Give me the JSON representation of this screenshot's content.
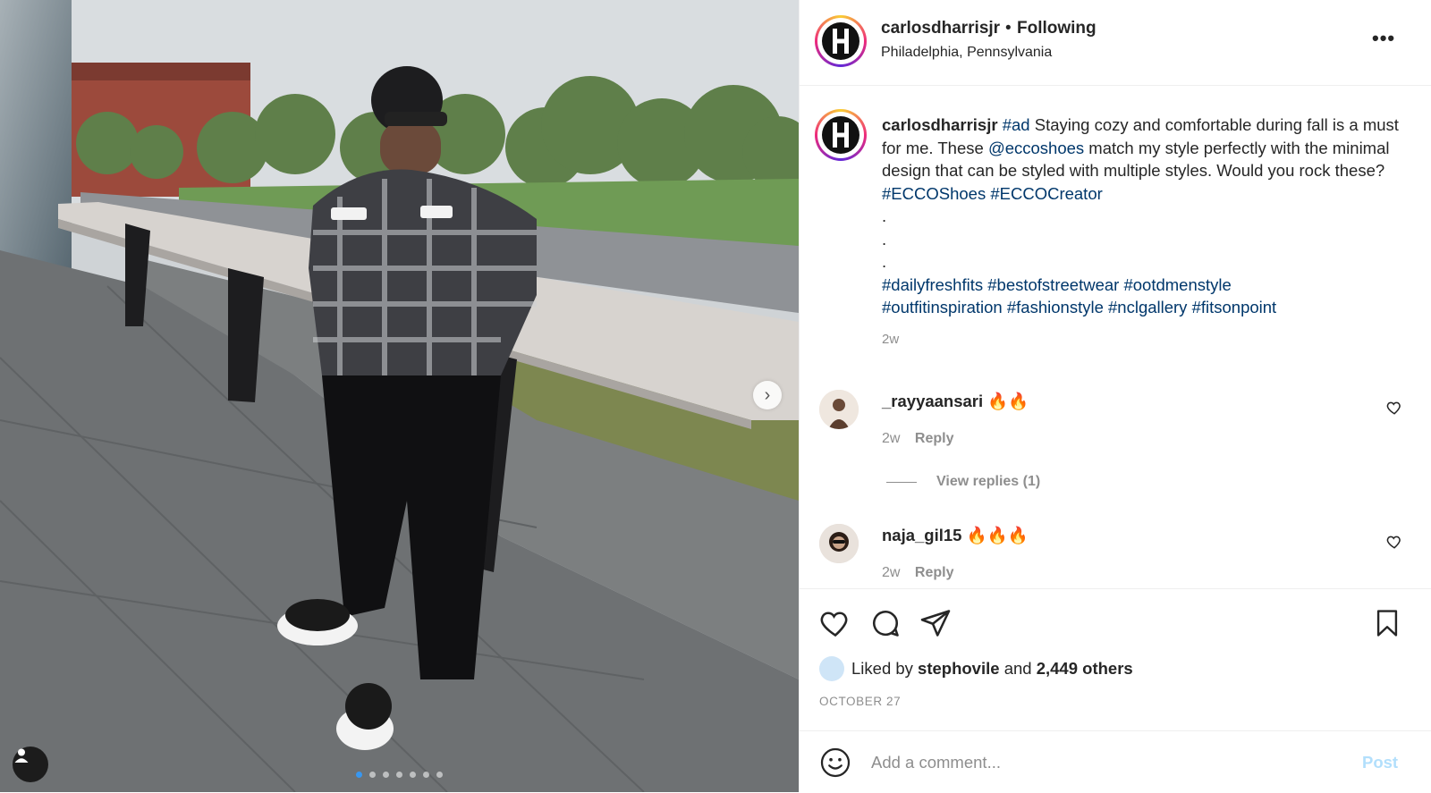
{
  "post": {
    "author": "carlosdharrisjr",
    "separator": "•",
    "follow_status": "Following",
    "location": "Philadelphia, Pennsylvania",
    "more_icon": "more-horizontal-icon",
    "more_label": "•••"
  },
  "photo": {
    "next_icon": "chevron-right-icon",
    "next_label": "›",
    "user_tag_icon": "user-icon",
    "carousel_count": 7,
    "carousel_active_index": 0
  },
  "caption": {
    "author": "carlosdharrisjr",
    "hashtag_ad": "#ad",
    "text_part1": " Staying cozy and comfortable during fall is a must for me. These ",
    "mention": "@eccoshoes",
    "text_part2": " match my style perfectly with the minimal design that can be styled with multiple styles. Would you rock these? ",
    "hashtag_shoes": "#ECCOShoes",
    "hashtag_creator": "#ECCOCreator",
    "bullets": [
      ".",
      ".",
      "."
    ],
    "hashtags": [
      "#dailyfreshfits",
      "#bestofstreetwear",
      "#ootdmenstyle",
      "#outfitinspiration",
      "#fashionstyle",
      "#nclgallery",
      "#fitsonpoint"
    ],
    "time": "2w"
  },
  "comments": [
    {
      "username": "_rayyaansari",
      "text": "🔥🔥",
      "time": "2w",
      "reply_label": "Reply"
    },
    {
      "username": "naja_gil15",
      "text": "🔥🔥🔥",
      "time": "2w",
      "reply_label": "Reply"
    }
  ],
  "view_replies_label": "View replies (1)",
  "likes": {
    "liked_by_prefix": "Liked by",
    "liked_by_user": "stephovile",
    "and": "and",
    "others_count": "2,449 others"
  },
  "date": "OCTOBER 27",
  "composer": {
    "placeholder": "Add a comment...",
    "post_label": "Post"
  },
  "colors": {
    "link": "#00376b",
    "muted": "#8e8e8e",
    "post_disabled": "#b2dffc",
    "carousel_active": "#3897f0"
  }
}
